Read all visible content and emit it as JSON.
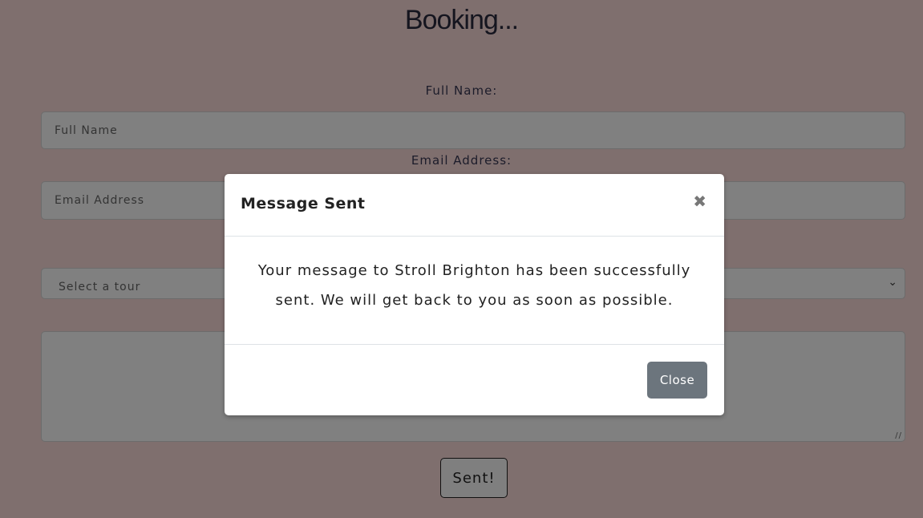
{
  "page": {
    "title": "Booking..."
  },
  "form": {
    "full_name_label": "Full Name:",
    "full_name_placeholder": "Full Name",
    "email_label": "Email Address:",
    "email_placeholder": "Email Address",
    "tour_select": "Select a tour",
    "message_value": "",
    "submit_label": "Sent!"
  },
  "modal": {
    "title": "Message Sent",
    "close_x": "✖",
    "body": "Your message to Stroll Brighton has been successfully sent. We will get back to you as soon as possible.",
    "close_label": "Close"
  },
  "colors": {
    "background": "#7f6f6e",
    "input": "#808080",
    "close_button": "#6c757d"
  }
}
